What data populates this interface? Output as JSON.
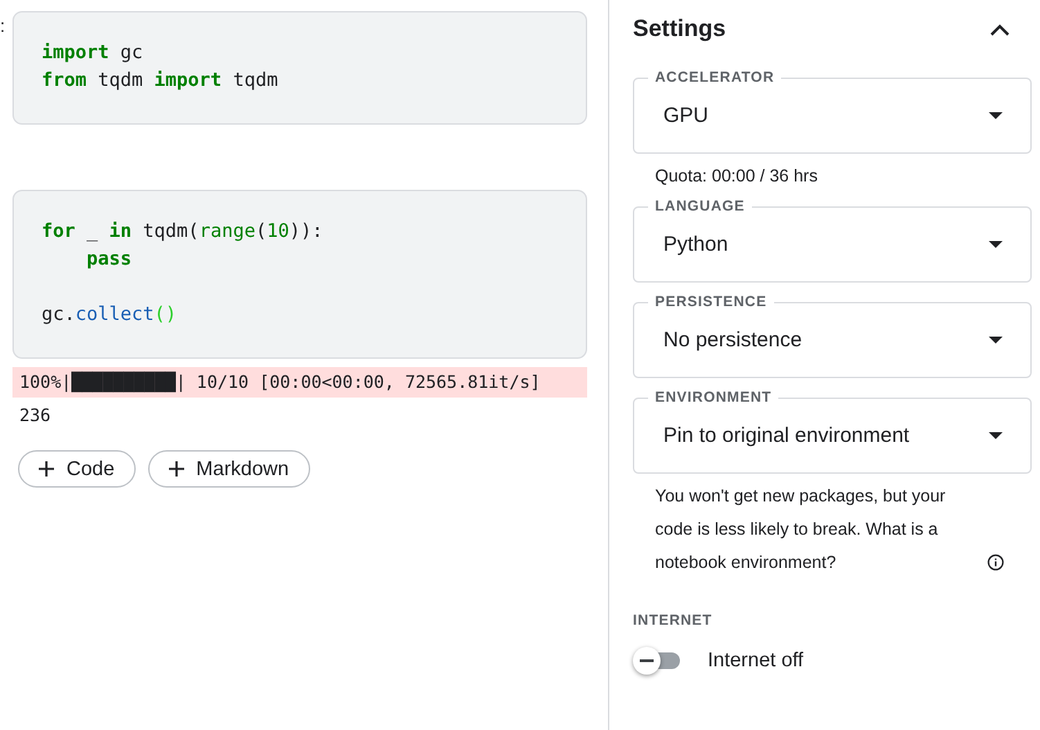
{
  "gutter_mark": ":",
  "cells": [
    {
      "blocks": [
        [
          {
            "tokens": [
              {
                "kind": "kw",
                "text": "import"
              },
              {
                "kind": "plain",
                "text": " gc"
              }
            ]
          },
          {
            "tokens": [
              {
                "kind": "kw",
                "text": "from"
              },
              {
                "kind": "plain",
                "text": " tqdm "
              },
              {
                "kind": "kw",
                "text": "import"
              },
              {
                "kind": "plain",
                "text": " tqdm"
              }
            ]
          }
        ]
      ]
    },
    {
      "blocks": [
        [
          {
            "tokens": [
              {
                "kind": "kw",
                "text": "for"
              },
              {
                "kind": "plain",
                "text": " _ "
              },
              {
                "kind": "kw",
                "text": "in"
              },
              {
                "kind": "plain",
                "text": " tqdm("
              },
              {
                "kind": "builtin",
                "text": "range"
              },
              {
                "kind": "plain",
                "text": "("
              },
              {
                "kind": "num",
                "text": "10"
              },
              {
                "kind": "plain",
                "text": ")):"
              }
            ]
          },
          {
            "tokens": [
              {
                "kind": "kw",
                "text": "    pass"
              }
            ]
          }
        ],
        [
          {
            "tokens": [
              {
                "kind": "plain",
                "text": "gc."
              },
              {
                "kind": "fn",
                "text": "collect"
              },
              {
                "kind": "paren",
                "text": "()"
              }
            ]
          }
        ]
      ],
      "outputs": [
        {
          "kind": "stderr",
          "text": "100%|██████████| 10/10 [00:00<00:00, 72565.81it/s]"
        },
        {
          "kind": "result",
          "text": "236"
        }
      ]
    }
  ],
  "add_buttons": [
    "Code",
    "Markdown"
  ],
  "settings": {
    "title": "Settings",
    "expanded": true,
    "fields": [
      {
        "label": "ACCELERATOR",
        "value": "GPU",
        "help": "Quota: 00:00 / 36 hrs"
      },
      {
        "label": "LANGUAGE",
        "value": "Python"
      },
      {
        "label": "PERSISTENCE",
        "value": "No persistence"
      },
      {
        "label": "ENVIRONMENT",
        "value": "Pin to original environment",
        "help": "You won't get new packages, but your code is less likely to break. What is a notebook environment?",
        "help_info": true
      }
    ],
    "internet": {
      "label": "INTERNET",
      "toggle_label": "Internet off",
      "on": false
    }
  }
}
